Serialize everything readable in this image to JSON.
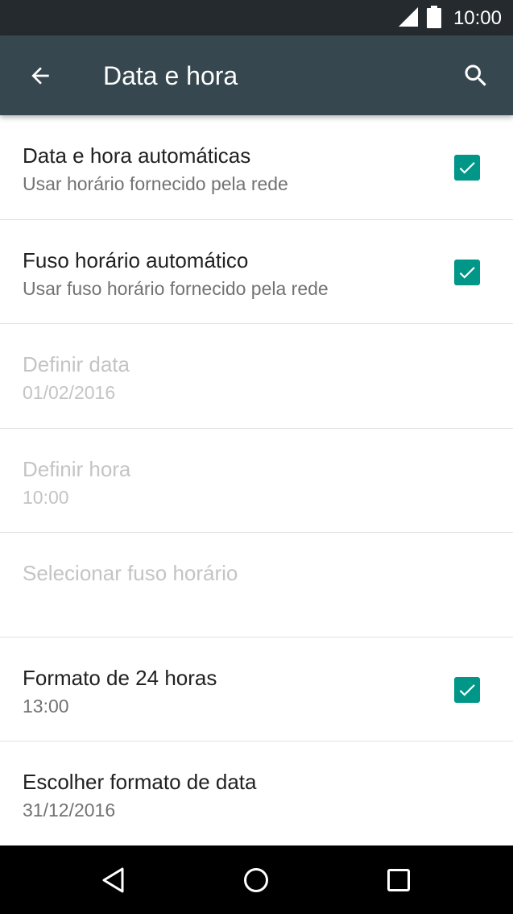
{
  "status_bar": {
    "time": "10:00",
    "icons": [
      "cell-signal-icon",
      "battery-icon"
    ]
  },
  "app_bar": {
    "title": "Data e hora",
    "icons": [
      "back-arrow-icon",
      "search-icon"
    ],
    "color": "#37474f"
  },
  "settings": [
    {
      "title": "Data e hora automáticas",
      "summary": "Usar horário fornecido pela rede",
      "checked": true,
      "enabled": true
    },
    {
      "title": "Fuso horário automático",
      "summary": "Usar fuso horário fornecido pela rede",
      "checked": true,
      "enabled": true
    },
    {
      "title": "Definir data",
      "summary": "01/02/2016",
      "enabled": false
    },
    {
      "title": "Definir hora",
      "summary": "10:00",
      "enabled": false
    },
    {
      "title": "Selecionar fuso horário",
      "summary": "",
      "enabled": false
    },
    {
      "title": "Formato de 24 horas",
      "summary": "13:00",
      "checked": true,
      "enabled": true
    },
    {
      "title": "Escolher formato de data",
      "summary": "31/12/2016",
      "enabled": true
    }
  ],
  "accent_color": "#009688",
  "nav_bar": {
    "icons": [
      "nav-back-icon",
      "nav-home-icon",
      "nav-recents-icon"
    ]
  }
}
